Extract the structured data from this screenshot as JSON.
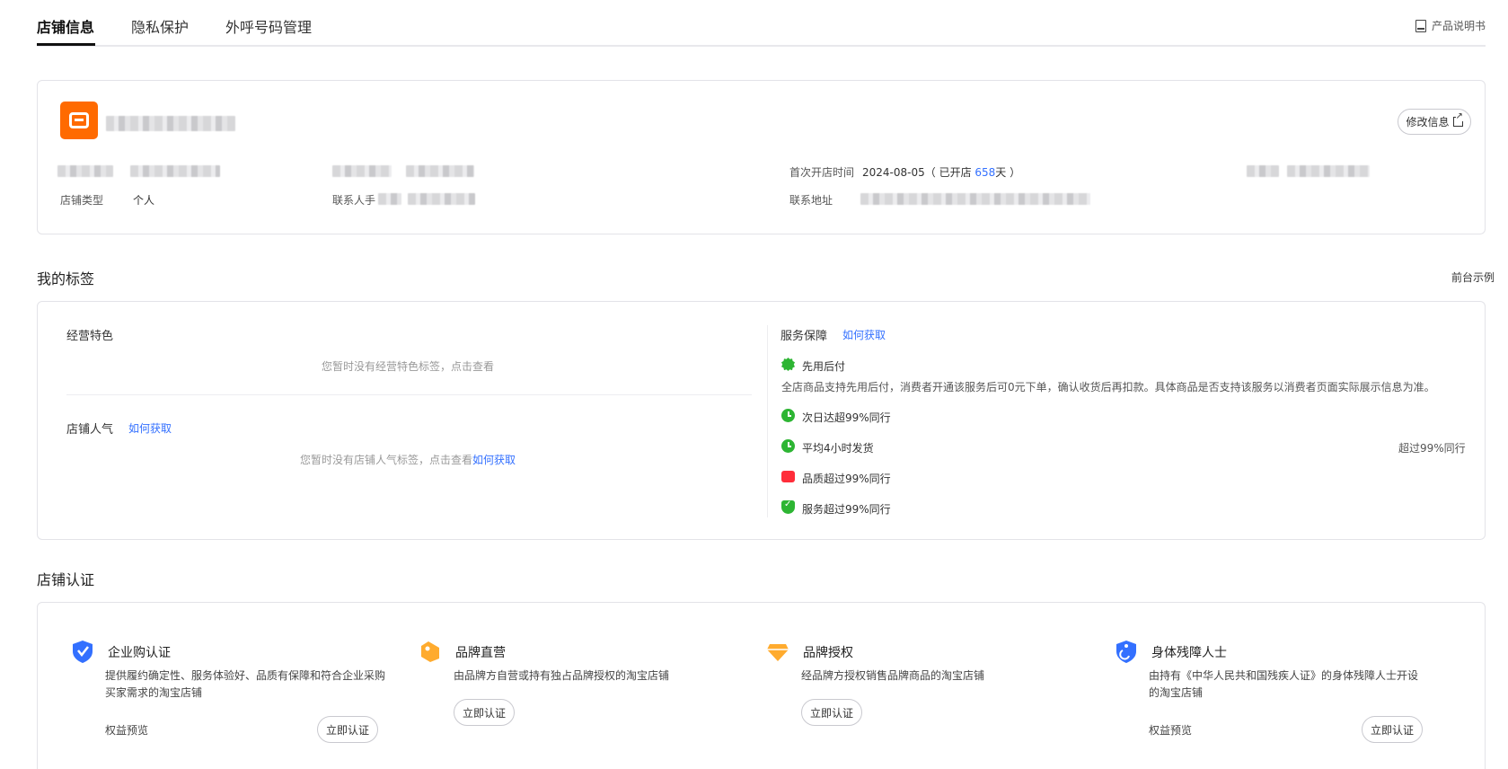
{
  "tabs": [
    {
      "label": "店铺信息"
    },
    {
      "label": "隐私保护"
    },
    {
      "label": "外呼号码管理"
    }
  ],
  "manual_label": "产品说明书",
  "shop": {
    "edit_button": "修改信息",
    "first_open_label": "首次开店时间",
    "first_open_date": "2024-08-05",
    "open_prefix": "（ 已开店 ",
    "open_days": "658",
    "open_suffix": "天 ）",
    "type_label": "店铺类型",
    "type_value": "个人",
    "contact_label": "联系人手",
    "address_label": "联系地址"
  },
  "tags": {
    "section_title": "我的标签",
    "preview_link": "前台示例",
    "features_title": "经营特色",
    "features_empty": "您暂时没有经营特色标签，点击查看",
    "popularity_title": "店铺人气",
    "how_to_get": "如何获取",
    "popularity_empty": "您暂时没有店铺人气标签，点击查看",
    "popularity_empty_link": "如何获取",
    "service_title": "服务保障",
    "service_how": "如何获取",
    "services": [
      {
        "icon": "gear-icon",
        "label": "先用后付"
      },
      {
        "icon": "clock-icon",
        "label": "次日达超99%同行"
      },
      {
        "icon": "clock-icon",
        "label": "平均4小时发货"
      },
      {
        "icon": "thumb-up-icon",
        "label": "品质超过99%同行"
      },
      {
        "icon": "shield-check-icon",
        "label": "服务超过99%同行"
      }
    ],
    "pay_later_desc": "全店商品支持先用后付，消费者开通该服务后可0元下单，确认收货后再扣款。具体商品是否支持该服务以消费者页面实际展示信息为准。",
    "ship_right": "超过99%同行"
  },
  "certs": {
    "section_title": "店铺认证",
    "items": [
      {
        "name": "企业购认证",
        "desc": "提供履约确定性、服务体验好、品质有保障和符合企业采购买家需求的淘宝店铺",
        "benefit": "权益预览",
        "button": "立即认证"
      },
      {
        "name": "品牌直营",
        "desc": "由品牌方自营或持有独占品牌授权的淘宝店铺",
        "button": "立即认证"
      },
      {
        "name": "品牌授权",
        "desc": "经品牌方授权销售品牌商品的淘宝店铺",
        "button": "立即认证"
      },
      {
        "name": "身体残障人士",
        "desc": "由持有《中华人民共和国残疾人证》的身体残障人士开设的淘宝店铺",
        "benefit": "权益预览",
        "button": "立即认证"
      }
    ]
  },
  "colors": {
    "accent": "#3370ff",
    "brand": "#ff6a00",
    "green": "#2db533",
    "red": "#ff2d3a"
  }
}
